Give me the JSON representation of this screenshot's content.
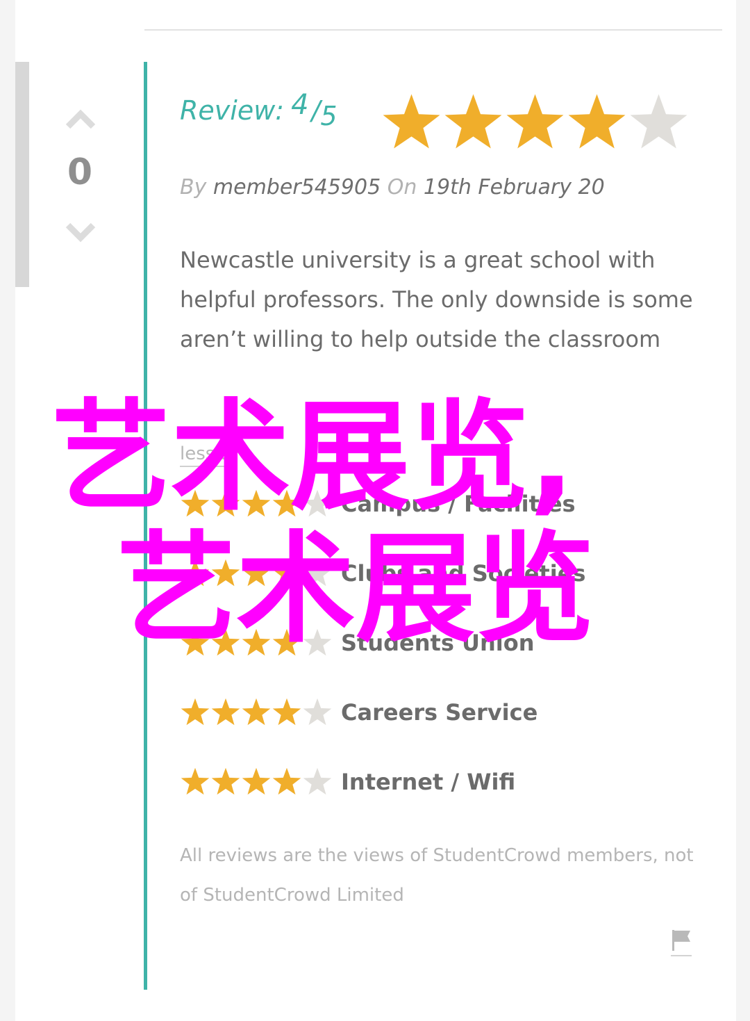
{
  "vote": {
    "count": "0"
  },
  "review": {
    "label": "Review:",
    "score": "4",
    "slash": "/",
    "out_of": "5",
    "rating": 4,
    "max": 5,
    "by_label": "By",
    "member": "member545905",
    "on_label": "On",
    "date": "19th February 20",
    "text": "Newcastle university is a great school with helpful professors. The only downside is some aren’t willing to help outside the classroom",
    "less_label": "less..."
  },
  "ratings": [
    {
      "label": "Campus / Facilities",
      "stars": 4
    },
    {
      "label": "Clubs and Societies",
      "stars": 4
    },
    {
      "label": "Students Union",
      "stars": 4
    },
    {
      "label": "Careers Service",
      "stars": 4
    },
    {
      "label": "Internet / Wifi",
      "stars": 4
    }
  ],
  "disclaimer": "All reviews are the views of StudentCrowd members, not of StudentCrowd Limited",
  "watermark": {
    "line1": "艺术展览,",
    "line2": "艺术展览"
  },
  "colors": {
    "accent": "#3fb3a8",
    "star_filled": "#f0ae2b",
    "star_empty": "#e0deda",
    "watermark": "#ff00ff"
  },
  "icons": {
    "vote_up": "chevron-up-icon",
    "vote_down": "chevron-down-icon",
    "star": "star-icon",
    "flag": "flag-icon"
  }
}
